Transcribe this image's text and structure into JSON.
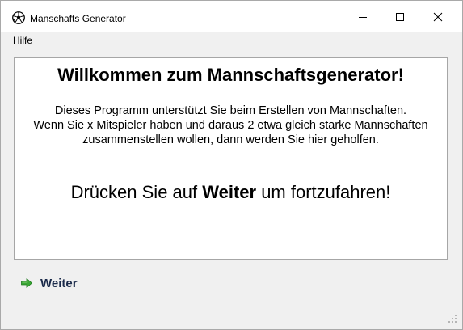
{
  "window": {
    "title": "Manschafts Generator"
  },
  "menu": {
    "items": [
      "Hilfe"
    ]
  },
  "content": {
    "heading": "Willkommen zum Mannschaftsgenerator!",
    "description_lines": [
      "Dieses Programm unterstützt Sie beim Erstellen von Mannschaften.",
      "Wenn Sie x Mitspieler haben und daraus 2 etwa gleich starke Mannschaften",
      "zusammenstellen wollen, dann werden Sie hier geholfen."
    ],
    "prompt_before": "Drücken Sie auf ",
    "prompt_bold": "Weiter",
    "prompt_after": " um fortzufahren!"
  },
  "next_button": {
    "label": "Weiter",
    "icon": "arrow-right-icon"
  },
  "colors": {
    "window_bg": "#f0f0f0",
    "panel_bg": "#ffffff",
    "next_label": "#1a2a4a",
    "arrow_green": "#3aa635"
  }
}
